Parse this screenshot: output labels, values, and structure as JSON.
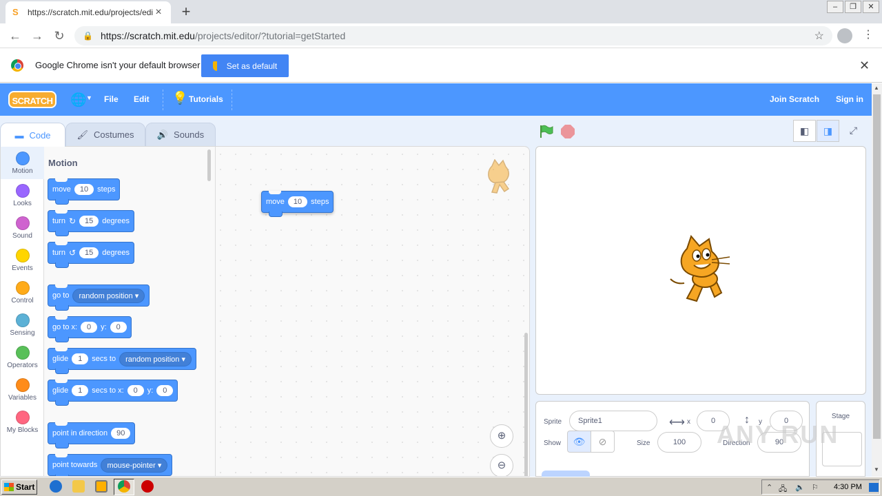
{
  "browser": {
    "tab_title": "https://scratch.mit.edu/projects/edit",
    "tab_favicon": "S",
    "url": "https://scratch.mit.edu/projects/editor/?tutorial=getStarted",
    "url_host": "https://scratch.mit.edu",
    "url_path": "/projects/editor/?tutorial=getStarted",
    "infobar_text": "Google Chrome isn't your default browser",
    "set_default_label": "Set as default"
  },
  "scratch": {
    "logo": "SCRATCH",
    "menu": {
      "file": "File",
      "edit": "Edit",
      "tutorials": "Tutorials",
      "join": "Join Scratch",
      "signin": "Sign in"
    },
    "tabs": {
      "code": "Code",
      "costumes": "Costumes",
      "sounds": "Sounds"
    },
    "categories": [
      {
        "label": "Motion",
        "color": "#4c97ff"
      },
      {
        "label": "Looks",
        "color": "#9966ff"
      },
      {
        "label": "Sound",
        "color": "#cf63cf"
      },
      {
        "label": "Events",
        "color": "#ffd500"
      },
      {
        "label": "Control",
        "color": "#ffab19"
      },
      {
        "label": "Sensing",
        "color": "#5cb1d6"
      },
      {
        "label": "Operators",
        "color": "#59c059"
      },
      {
        "label": "Variables",
        "color": "#ff8c1a"
      },
      {
        "label": "My Blocks",
        "color": "#ff6680"
      }
    ],
    "palette_title": "Motion",
    "blocks": {
      "move": {
        "a": "move",
        "n": "10",
        "b": "steps"
      },
      "turn_right": {
        "a": "turn",
        "n": "15",
        "b": "degrees"
      },
      "turn_left": {
        "a": "turn",
        "n": "15",
        "b": "degrees"
      },
      "goto": {
        "a": "go to",
        "drop": "random position"
      },
      "gotoxy": {
        "a": "go to x:",
        "x": "0",
        "ylbl": "y:",
        "y": "0"
      },
      "glide": {
        "a": "glide",
        "n": "1",
        "b": "secs to",
        "drop": "random position"
      },
      "glidexy": {
        "a": "glide",
        "n": "1",
        "b": "secs to x:",
        "x": "0",
        "ylbl": "y:",
        "y": "0"
      },
      "pointdir": {
        "a": "point in direction",
        "n": "90"
      },
      "pointtowards": {
        "a": "point towards",
        "drop": "mouse-pointer"
      }
    },
    "script_block": {
      "a": "move",
      "n": "10",
      "b": "steps"
    },
    "sprite": {
      "sprite_label": "Sprite",
      "name": "Sprite1",
      "x_label": "x",
      "x": "0",
      "y_label": "y",
      "y": "0",
      "show_label": "Show",
      "size_label": "Size",
      "size": "100",
      "direction_label": "Direction",
      "direction": "90"
    },
    "stage_label": "Stage"
  },
  "taskbar": {
    "start": "Start",
    "clock": "4:30 PM"
  },
  "watermark": "ANY RUN"
}
